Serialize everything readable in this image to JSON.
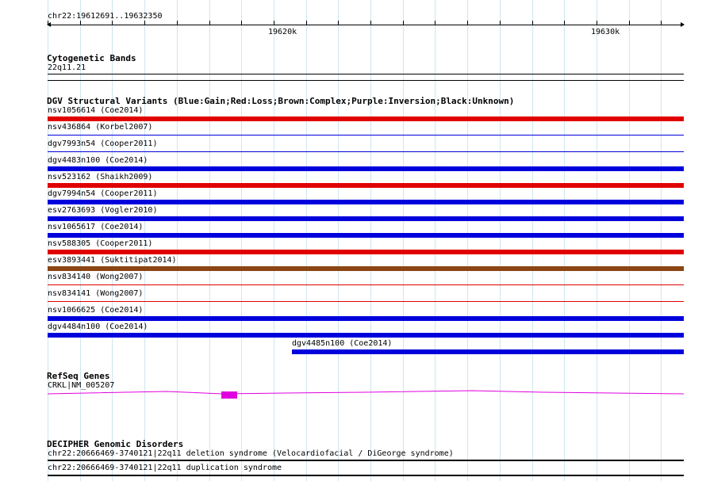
{
  "ruler": {
    "location": "chr22:19612691..19632350",
    "label_20k": "19620k",
    "label_30k": "19630k"
  },
  "cytobands": {
    "title": "Cytogenetic Bands",
    "band": "22q11.21"
  },
  "dgv": {
    "title": "DGV Structural Variants (Blue:Gain;Red:Loss;Brown:Complex;Purple:Inversion;Black:Unknown)",
    "colors": {
      "gain": "#0000dd",
      "loss": "#e00000",
      "complex": "#8b4513"
    },
    "features": [
      {
        "label": "nsv1056614 (Coe2014)",
        "type": "loss"
      },
      {
        "label": "nsv436864 (Korbel2007)",
        "type": "gain"
      },
      {
        "label": "dgv7993n54 (Cooper2011)",
        "type": "gain"
      },
      {
        "label": "dgv4483n100 (Coe2014)",
        "type": "gain"
      },
      {
        "label": "nsv523162 (Shaikh2009)",
        "type": "loss"
      },
      {
        "label": "dgv7994n54 (Cooper2011)",
        "type": "gain"
      },
      {
        "label": "esv2763693 (Vogler2010)",
        "type": "gain"
      },
      {
        "label": "nsv1065617 (Coe2014)",
        "type": "gain"
      },
      {
        "label": "nsv588305 (Cooper2011)",
        "type": "loss"
      },
      {
        "label": "esv3893441 (Suktitipat2014)",
        "type": "complex"
      },
      {
        "label": "nsv834140 (Wong2007)",
        "type": "loss"
      },
      {
        "label": "nsv834141 (Wong2007)",
        "type": "loss"
      },
      {
        "label": "nsv1066625 (Coe2014)",
        "type": "gain"
      },
      {
        "label": "dgv4484n100 (Coe2014)",
        "type": "gain"
      },
      {
        "label": "dgv4485n100 (Coe2014)",
        "type": "gain"
      }
    ]
  },
  "refseq": {
    "title": "RefSeq Genes",
    "gene_label": "CRKL|NM_005207",
    "color": "#e000e0"
  },
  "decipher": {
    "title": "DECIPHER Genomic Disorders",
    "items": [
      {
        "label": "chr22:20666469-3740121|22q11 deletion syndrome (Velocardiofacial / DiGeorge syndrome)"
      },
      {
        "label": "chr22:20666469-3740121|22q11 duplication syndrome"
      }
    ]
  }
}
